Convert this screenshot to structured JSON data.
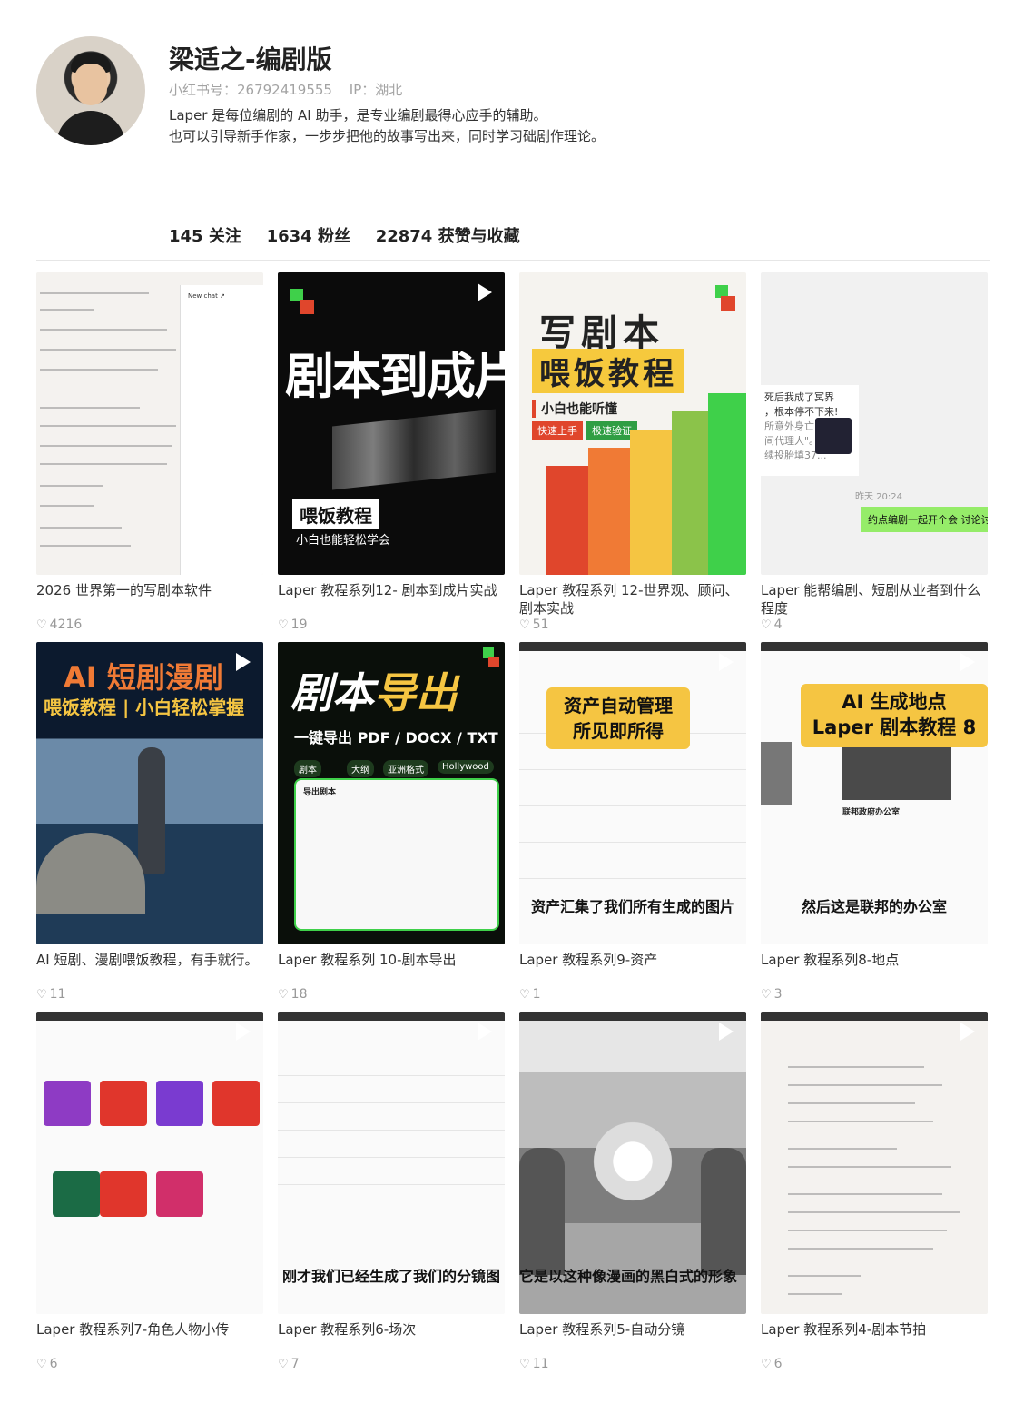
{
  "profile": {
    "name": "梁适之-编剧版",
    "red_id": "小红书号：26792419555",
    "ip": "IP：湖北",
    "bio_line1": "Laper 是每位编剧的 AI 助手，是专业编剧最得心应手的辅助。",
    "bio_line2": "也可以引导新手作家，一步步把他的故事写出来，同时学习础剧作理论。"
  },
  "stats": {
    "following": "145 关注",
    "followers": "1634 粉丝",
    "likes": "22874 获赞与收藏"
  },
  "icons": {
    "like": "heart-outline-icon",
    "play": "play-icon"
  },
  "colors": {
    "accent_yellow": "#f5c542",
    "accent_orange": "#f07a35",
    "accent_green": "#3fd04a"
  },
  "cards": [
    {
      "title": "2026 世界第一的写剧本软件",
      "likes": "4216",
      "thumb": {
        "panel_title": "New chat ↗"
      }
    },
    {
      "title": "Laper 教程系列12- 剧本到成片实战",
      "likes": "19",
      "thumb": {
        "headline": "剧本到成片",
        "tag": "喂饭教程",
        "sub": "小白也能轻松学会"
      }
    },
    {
      "title": "Laper 教程系列 12-世界观、顾问、剧本实战",
      "likes": "51",
      "thumb": {
        "h1": "写剧本",
        "h2": "喂饭教程",
        "h3": "小白也能听懂",
        "b1": "快速上手",
        "b2": "极速验证"
      }
    },
    {
      "title": "Laper 能帮编剧、短剧从业者到什么程度",
      "likes": "4",
      "thumb": {
        "bubble1": "死后我成了冥界",
        "bubble2": "，根本停不下来!",
        "bubble3": "所意外身亡,",
        "bubble4": "间代理人\"。",
        "bubble5": "续投胎填37...",
        "time": "昨天 20:24",
        "green": "约点编剧一起开个会 讨论讨"
      }
    },
    {
      "title": "AI 短剧、漫剧喂饭教程，有手就行。",
      "likes": "11",
      "thumb": {
        "h1": "AI 短剧漫剧",
        "h2": "喂饭教程 | 小白轻松掌握"
      }
    },
    {
      "title": "Laper 教程系列 10-剧本导出",
      "likes": "18",
      "thumb": {
        "h1a": "剧本",
        "h1b": "导出",
        "h2": "一键导出 PDF / DOCX / TXT",
        "chips": [
          "剧本",
          "大纲",
          "亚洲格式",
          "Hollywood"
        ],
        "modal_title": "导出剧本"
      }
    },
    {
      "title": "Laper 教程系列9-资产",
      "likes": "1",
      "thumb": {
        "box": "资产自动管理\n所见即所得",
        "caption": "资产汇集了我们所有生成的图片"
      }
    },
    {
      "title": "Laper 教程系列8-地点",
      "likes": "3",
      "thumb": {
        "box": "AI 生成地点\nLaper 剧本教程 8",
        "card_title": "联邦政府办公室",
        "caption": "然后这是联邦的办公室"
      }
    },
    {
      "title": "Laper 教程系列7-角色人物小传",
      "likes": "6",
      "thumb": {}
    },
    {
      "title": "Laper 教程系列6-场次",
      "likes": "7",
      "thumb": {
        "caption": "刚才我们已经生成了我们的分镜图"
      }
    },
    {
      "title": "Laper 教程系列5-自动分镜",
      "likes": "11",
      "thumb": {
        "caption": "它是以这种像漫画的黑白式的形象"
      }
    },
    {
      "title": "Laper 教程系列4-剧本节拍",
      "likes": "6",
      "thumb": {}
    }
  ]
}
